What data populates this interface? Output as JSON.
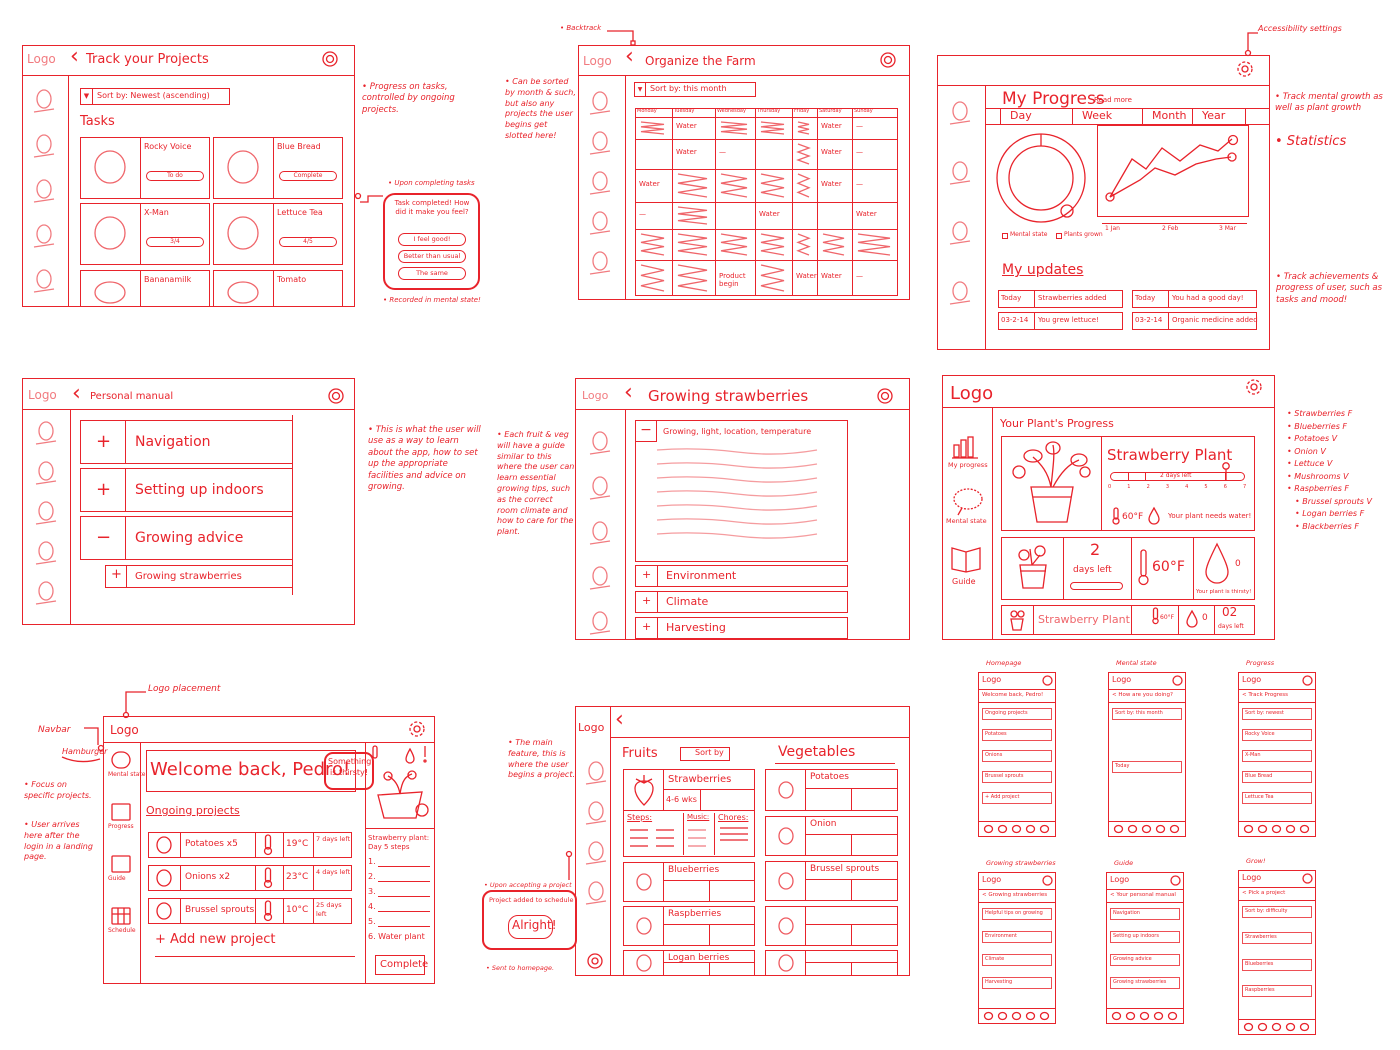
{
  "colors": {
    "ink": "#e8232b"
  },
  "track_projects": {
    "logo": "Logo",
    "title": "Track your Projects",
    "sort": "Sort by: Newest (ascending)",
    "section": "Tasks",
    "tasks": [
      {
        "name": "Rocky Voice",
        "status": "To do"
      },
      {
        "name": "Blue Bread",
        "status": "Complete"
      },
      {
        "name": "X-Man",
        "status": "3/4"
      },
      {
        "name": "Lettuce Tea",
        "status": "4/5"
      },
      {
        "name": "Bananamilk",
        "status": ""
      },
      {
        "name": "Tomato",
        "status": ""
      }
    ],
    "note": "• Progress on tasks, controlled by ongoing projects.",
    "popup_label": "• Upon completing tasks",
    "popup": {
      "title": "Task completed! How did it make you feel?",
      "options": [
        "I feel good!",
        "Better than usual",
        "The same"
      ]
    },
    "popup_footer": "• Recorded in mental state!"
  },
  "organize": {
    "logo": "Logo",
    "title": "Organize the Farm",
    "sort": "Sort by: this month",
    "backtrack": "• Backtrack",
    "note": "• Can be sorted by month & such, but also any projects the user begins get slotted here!",
    "days": [
      "Monday",
      "Tuesday",
      "Wednesday",
      "Thursday",
      "Friday",
      "Saturday",
      "Sunday"
    ],
    "rows": [
      [
        "~",
        "Water",
        "~",
        "~",
        "~",
        "Water",
        "—"
      ],
      [
        "",
        "Water",
        "—",
        "",
        "~",
        "Water",
        "—"
      ],
      [
        "Water",
        "~",
        "~",
        "~",
        "~",
        "Water",
        "—"
      ],
      [
        "—",
        "~",
        "",
        "Water",
        "",
        "",
        "Water"
      ],
      [
        "~",
        "~",
        "~",
        "~",
        "~",
        "~",
        "~"
      ],
      [
        "~",
        "~",
        "Product begin",
        "~",
        "Water",
        "Water",
        "—"
      ]
    ]
  },
  "progress": {
    "accessibility": "Accessibility settings",
    "title": "My Progress",
    "read_more": "Read more",
    "tabs": [
      "Day",
      "Week",
      "Month",
      "Year"
    ],
    "legend": [
      "Mental state",
      "Plants grown"
    ],
    "x_labels": [
      "1 Jan",
      "2 Feb",
      "3 Mar"
    ],
    "updates_title": "My updates",
    "updates": [
      {
        "date": "Today",
        "text": "Strawberries added"
      },
      {
        "date": "Today",
        "text": "You had a good day!"
      },
      {
        "date": "03-2-14",
        "text": "You grew lettuce!"
      },
      {
        "date": "03-2-14",
        "text": "Organic medicine added"
      }
    ],
    "notes": [
      "• Track mental growth as well as plant growth",
      "• Statistics",
      "• Track achievements & progress of user, such as tasks and mood!"
    ]
  },
  "manual": {
    "logo": "Logo",
    "title": "Personal manual",
    "items": [
      {
        "sign": "+",
        "label": "Navigation"
      },
      {
        "sign": "+",
        "label": "Setting up indoors"
      },
      {
        "sign": "−",
        "label": "Growing advice"
      }
    ],
    "sub_item": {
      "sign": "+",
      "label": "Growing strawberries"
    },
    "note": "• This is what the user will use as a way to learn about the app, how to set up the appropriate facilities and advice on growing."
  },
  "guide": {
    "logo": "Logo",
    "title": "Growing strawberries",
    "expanded": {
      "sign": "−",
      "label": "Growing, light, location, temperature"
    },
    "sections": [
      {
        "sign": "+",
        "label": "Environment"
      },
      {
        "sign": "+",
        "label": "Climate"
      },
      {
        "sign": "+",
        "label": "Harvesting"
      }
    ],
    "note": "• Each fruit & veg will have a guide similar to this where the user can learn essential growing tips, such as the correct room climate and how to care for the plant."
  },
  "plant": {
    "logo": "Logo",
    "title": "Your Plant's Progress",
    "nav": [
      "My progress",
      "Mental state",
      "Guide"
    ],
    "name": "Strawberry Plant",
    "scale": [
      "0",
      "1",
      "2",
      "3",
      "4",
      "5",
      "6",
      "7"
    ],
    "days_left": "2 days left",
    "progress_day": 6,
    "temp": "60°F",
    "water_msg": "Your plant needs water!",
    "cards": {
      "days_num": "2",
      "days_label": "days left",
      "temp": "60°F",
      "thirsty": "Your plant is thirsty!",
      "drop_value": "0"
    },
    "bar": {
      "name": "Strawberry Plant",
      "temp": "60°F",
      "water": "0",
      "days_num": "02",
      "days_label": "days left"
    },
    "produce": [
      "• Strawberries  F",
      "• Blueberries  F",
      "• Potatoes  V",
      "• Onion  V",
      "• Lettuce  V",
      "• Mushrooms  V",
      "• Raspberries  F",
      "• Brussel sprouts  V",
      "• Logan berries  F",
      "• Blackberries  F"
    ]
  },
  "home": {
    "logo_placement": "Logo placement",
    "navbar": "Navbar",
    "hamburger": "Hamburger",
    "notes": [
      "• Focus on specific projects.",
      "• User arrives here after the login in a landing page."
    ],
    "logo": "Logo",
    "nav": [
      "Mental state",
      "Progress",
      "Guide",
      "Schedule"
    ],
    "welcome": "Welcome back, Pedro!",
    "badge": "Something is thirsty!",
    "section": "Ongoing projects",
    "projects": [
      {
        "name": "Potatoes x5",
        "temp": "19°C",
        "days": "7 days left"
      },
      {
        "name": "Onions x2",
        "temp": "23°C",
        "days": "4 days left"
      },
      {
        "name": "Brussel sprouts",
        "temp": "10°C",
        "days": "25 days left"
      }
    ],
    "add": "+ Add new project",
    "steps_title": "Strawberry plant: Day 5 steps",
    "steps": [
      "1.",
      "2.",
      "3.",
      "4.",
      "5.",
      "6. Water plant"
    ],
    "complete": "Complete"
  },
  "catalog": {
    "logo": "Logo",
    "note": "• The main feature, this is where the user begins a project.",
    "fruits": "Fruits",
    "sort": "Sort by",
    "vegetables": "Vegetables",
    "fruit_items": [
      "Strawberries",
      "Blueberries",
      "Raspberries",
      "Logan berries"
    ],
    "strawberry": {
      "weeks": "4-6 wks",
      "steps": "Steps:",
      "music": "Music:",
      "chores": "Chores:"
    },
    "veg_items": [
      "Potatoes",
      "Onion",
      "Brussel sprouts",
      "",
      ""
    ],
    "popup_label": "• Upon accepting a project",
    "popup_text": "Project added to schedule",
    "popup_button": "Alright!",
    "popup_footer": "• Sent to homepage."
  },
  "mobile": [
    {
      "label": "Homepage",
      "logo": "Logo",
      "header": "Welcome back, Pedro!",
      "items": [
        "Ongoing projects",
        "Potatoes",
        "Onions",
        "Brussel sprouts",
        "+ Add project"
      ]
    },
    {
      "label": "Mental state",
      "logo": "Logo",
      "header": "< How are you doing?",
      "items": [
        "Sort by: this month",
        "Today"
      ]
    },
    {
      "label": "Progress",
      "logo": "Logo",
      "header": "< Track Progress",
      "items": [
        "Sort by: newest",
        "Rocky Voice",
        "X-Man",
        "Blue Bread",
        "Lettuce Tea"
      ]
    },
    {
      "label": "Growing strawberries",
      "logo": "Logo",
      "header": "< Growing strawberries",
      "items": [
        "Helpful tips on growing",
        "Environment",
        "Climate",
        "Harvesting"
      ]
    },
    {
      "label": "Guide",
      "logo": "Logo",
      "header": "< Your personal manual",
      "items": [
        "Navigation",
        "Setting up indoors",
        "Growing advice",
        "Growing strawberries"
      ]
    },
    {
      "label": "Grow!",
      "logo": "Logo",
      "header": "< Pick a project",
      "items": [
        "Sort by: difficulty",
        "Strawberries",
        "Blueberries",
        "Raspberries"
      ]
    }
  ]
}
